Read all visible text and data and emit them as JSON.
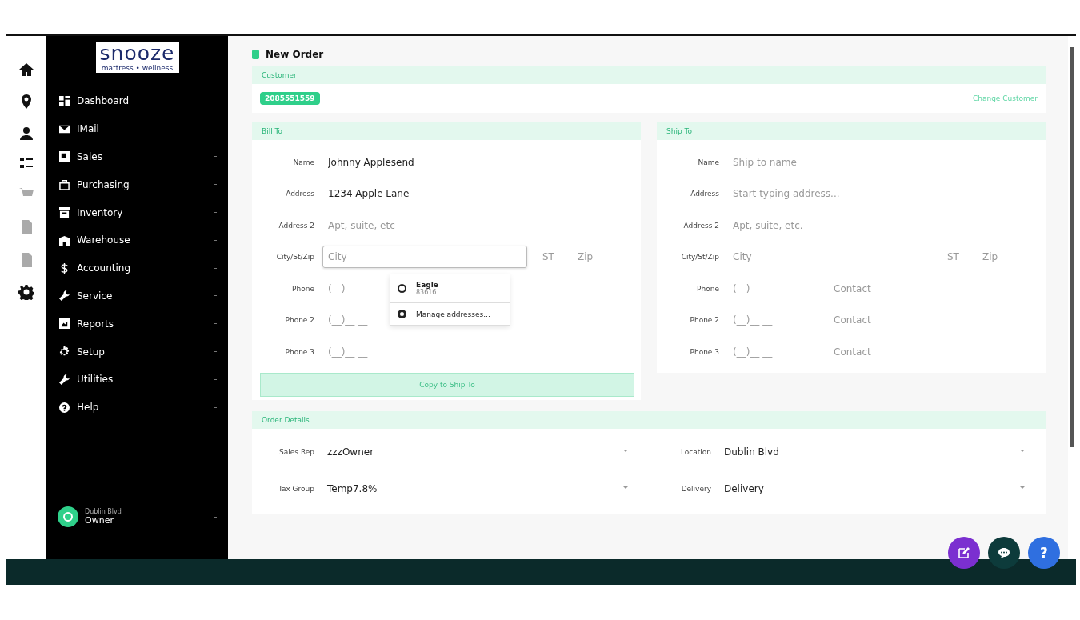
{
  "rail": [
    {
      "kind": "home",
      "disabled": false
    },
    {
      "kind": "pin",
      "disabled": false
    },
    {
      "kind": "user",
      "disabled": false
    },
    {
      "kind": "list",
      "disabled": false
    },
    {
      "kind": "cart",
      "disabled": true
    },
    {
      "kind": "doc",
      "disabled": true
    },
    {
      "kind": "doc",
      "disabled": true
    },
    {
      "kind": "gear",
      "disabled": false
    }
  ],
  "sidebar": {
    "logo": {
      "title": "snooze",
      "subtitle": "mattress • wellness"
    },
    "items": [
      {
        "label": "Dashboard",
        "kind": "grid",
        "submenu": false
      },
      {
        "label": "IMail",
        "kind": "mail",
        "submenu": false
      },
      {
        "label": "Sales",
        "kind": "square",
        "submenu": true
      },
      {
        "label": "Purchasing",
        "kind": "bag",
        "submenu": true
      },
      {
        "label": "Inventory",
        "kind": "box",
        "submenu": true
      },
      {
        "label": "Warehouse",
        "kind": "building",
        "submenu": true
      },
      {
        "label": "Accounting",
        "kind": "dollar",
        "submenu": true
      },
      {
        "label": "Service",
        "kind": "wrench",
        "submenu": true
      },
      {
        "label": "Reports",
        "kind": "chart",
        "submenu": true
      },
      {
        "label": "Setup",
        "kind": "gear",
        "submenu": true
      },
      {
        "label": "Utilities",
        "kind": "wrench",
        "submenu": true
      },
      {
        "label": "Help",
        "kind": "help",
        "submenu": true
      }
    ],
    "user": {
      "location": "Dublin Blvd",
      "role": "Owner"
    }
  },
  "page": {
    "title": "New Order",
    "customer": {
      "heading": "Customer",
      "customer_id": "2085551559",
      "change_link": "Change Customer"
    },
    "bill_to": {
      "heading": "Bill To",
      "fields": [
        {
          "kind": "text",
          "label": "Name",
          "value": "Johnny Applesend"
        },
        {
          "kind": "text",
          "label": "Address",
          "value": "1234 Apple Lane"
        },
        {
          "kind": "text",
          "label": "Address 2",
          "placeholder": "Apt, suite, etc"
        },
        {
          "kind": "city",
          "label": "City/St/Zip",
          "city_placeholder": "City",
          "state_placeholder": "ST",
          "zip_placeholder": "Zip",
          "focused": true
        },
        {
          "kind": "phone",
          "label": "Phone",
          "placeholder": "(__)__ __"
        },
        {
          "kind": "phone",
          "label": "Phone 2",
          "placeholder": "(__)__ __"
        },
        {
          "kind": "phone",
          "label": "Phone 3",
          "placeholder": "(__)__ __"
        }
      ],
      "suggestions": [
        {
          "kind": "place",
          "title": "Eagle",
          "detail": "83616"
        },
        {
          "kind": "manage",
          "title": "Manage addresses..."
        }
      ],
      "copy_button": "Copy to Ship To"
    },
    "ship_to": {
      "heading": "Ship To",
      "fields": [
        {
          "kind": "text",
          "label": "Name",
          "placeholder": "Ship to name"
        },
        {
          "kind": "text",
          "label": "Address",
          "placeholder": "Start typing address..."
        },
        {
          "kind": "text",
          "label": "Address 2",
          "placeholder": "Apt, suite, etc."
        },
        {
          "kind": "city",
          "label": "City/St/Zip",
          "city_placeholder": "City",
          "state_placeholder": "ST",
          "zip_placeholder": "Zip",
          "focused": false
        },
        {
          "kind": "phone",
          "label": "Phone",
          "placeholder": "(__)__ __",
          "contact_placeholder": "Contact"
        },
        {
          "kind": "phone",
          "label": "Phone 2",
          "placeholder": "(__)__ __",
          "contact_placeholder": "Contact"
        },
        {
          "kind": "phone",
          "label": "Phone 3",
          "placeholder": "(__)__ __",
          "contact_placeholder": "Contact"
        }
      ]
    },
    "order_details": {
      "heading": "Order Details",
      "fields": [
        {
          "label": "Sales Rep",
          "value": "zzzOwner"
        },
        {
          "label": "Location",
          "value": "Dublin Blvd"
        },
        {
          "label": "Tax Group",
          "value": "Temp7.8%"
        },
        {
          "label": "Delivery",
          "value": "Delivery"
        }
      ]
    }
  },
  "fabs": [
    {
      "kind": "edit"
    },
    {
      "kind": "chat"
    },
    {
      "kind": "help",
      "text": "?"
    }
  ]
}
